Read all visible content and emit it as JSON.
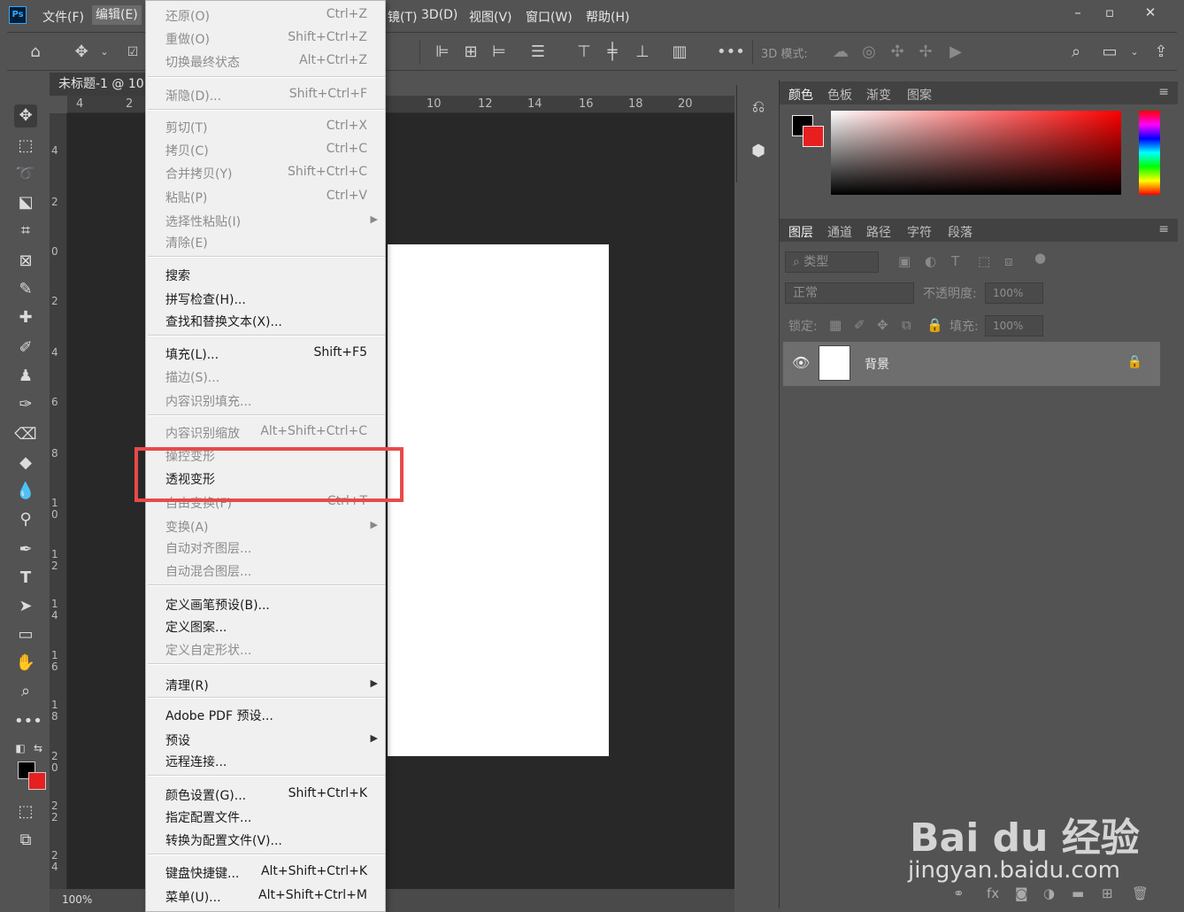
{
  "app": {
    "logo": "Ps"
  },
  "menubar": {
    "items": [
      "文件(F)",
      "编辑(E)",
      "镜(T)",
      "3D(D)",
      "视图(V)",
      "窗口(W)",
      "帮助(H)"
    ]
  },
  "window_buttons": {
    "minimize": "–",
    "restore": "▫",
    "close": "✕"
  },
  "options": {
    "mode_3d_label": "3D 模式:"
  },
  "document": {
    "tab_title": "未标题-1 @ 10",
    "zoom": "100%",
    "ruler_h": [
      "4",
      "2",
      "10",
      "12",
      "14",
      "16",
      "18",
      "20"
    ],
    "ruler_v": [
      "4",
      "2",
      "0",
      "2",
      "4",
      "6",
      "8",
      "10",
      "12",
      "14",
      "16",
      "18",
      "20",
      "22",
      "24"
    ]
  },
  "edit_menu": {
    "items": [
      {
        "label": "还原(O)",
        "shortcut": "Ctrl+Z",
        "disabled": true
      },
      {
        "label": "重做(O)",
        "shortcut": "Shift+Ctrl+Z",
        "disabled": true
      },
      {
        "label": "切换最终状态",
        "shortcut": "Alt+Ctrl+Z",
        "disabled": true
      },
      {
        "label": "渐隐(D)...",
        "shortcut": "Shift+Ctrl+F",
        "disabled": true
      },
      {
        "label": "剪切(T)",
        "shortcut": "Ctrl+X",
        "disabled": true
      },
      {
        "label": "拷贝(C)",
        "shortcut": "Ctrl+C",
        "disabled": true
      },
      {
        "label": "合并拷贝(Y)",
        "shortcut": "Shift+Ctrl+C",
        "disabled": true
      },
      {
        "label": "粘贴(P)",
        "shortcut": "Ctrl+V",
        "disabled": true
      },
      {
        "label": "选择性粘贴(I)",
        "shortcut": "",
        "disabled": true
      },
      {
        "label": "清除(E)",
        "shortcut": "",
        "disabled": true
      },
      {
        "label": "搜索",
        "shortcut": "",
        "disabled": false
      },
      {
        "label": "拼写检查(H)...",
        "shortcut": "",
        "disabled": false
      },
      {
        "label": "查找和替换文本(X)...",
        "shortcut": "",
        "disabled": false
      },
      {
        "label": "填充(L)...",
        "shortcut": "Shift+F5",
        "disabled": false
      },
      {
        "label": "描边(S)...",
        "shortcut": "",
        "disabled": true
      },
      {
        "label": "内容识别填充...",
        "shortcut": "",
        "disabled": true
      },
      {
        "label": "内容识别缩放",
        "shortcut": "Alt+Shift+Ctrl+C",
        "disabled": true
      },
      {
        "label": "操控变形",
        "shortcut": "",
        "disabled": true
      },
      {
        "label": "透视变形",
        "shortcut": "",
        "disabled": false
      },
      {
        "label": "自由变换(F)",
        "shortcut": "Ctrl+T",
        "disabled": true
      },
      {
        "label": "变换(A)",
        "shortcut": "",
        "disabled": true
      },
      {
        "label": "自动对齐图层...",
        "shortcut": "",
        "disabled": true
      },
      {
        "label": "自动混合图层...",
        "shortcut": "",
        "disabled": true
      },
      {
        "label": "定义画笔预设(B)...",
        "shortcut": "",
        "disabled": false
      },
      {
        "label": "定义图案...",
        "shortcut": "",
        "disabled": false
      },
      {
        "label": "定义自定形状...",
        "shortcut": "",
        "disabled": true
      },
      {
        "label": "清理(R)",
        "shortcut": "",
        "disabled": false
      },
      {
        "label": "Adobe PDF 预设...",
        "shortcut": "",
        "disabled": false
      },
      {
        "label": "预设",
        "shortcut": "",
        "disabled": false
      },
      {
        "label": "远程连接...",
        "shortcut": "",
        "disabled": false
      },
      {
        "label": "颜色设置(G)...",
        "shortcut": "Shift+Ctrl+K",
        "disabled": false
      },
      {
        "label": "指定配置文件...",
        "shortcut": "",
        "disabled": false
      },
      {
        "label": "转换为配置文件(V)...",
        "shortcut": "",
        "disabled": false
      },
      {
        "label": "键盘快捷键...",
        "shortcut": "Alt+Shift+Ctrl+K",
        "disabled": false
      },
      {
        "label": "菜单(U)...",
        "shortcut": "Alt+Shift+Ctrl+M",
        "disabled": false
      }
    ]
  },
  "color_panel": {
    "tabs": [
      "颜色",
      "色板",
      "渐变",
      "图案"
    ],
    "foreground": "#000000",
    "background": "#e81f1f"
  },
  "layers_panel": {
    "tabs": [
      "图层",
      "通道",
      "路径",
      "字符",
      "段落"
    ],
    "filter_placeholder": "类型",
    "blend_mode": "正常",
    "opacity_label": "不透明度:",
    "opacity_value": "100%",
    "lock_label": "锁定:",
    "fill_label": "填充:",
    "fill_value": "100%",
    "layers": [
      {
        "name": "背景"
      }
    ]
  },
  "watermark": {
    "brand": "Bai du 经验",
    "url": "jingyan.baidu.com"
  }
}
